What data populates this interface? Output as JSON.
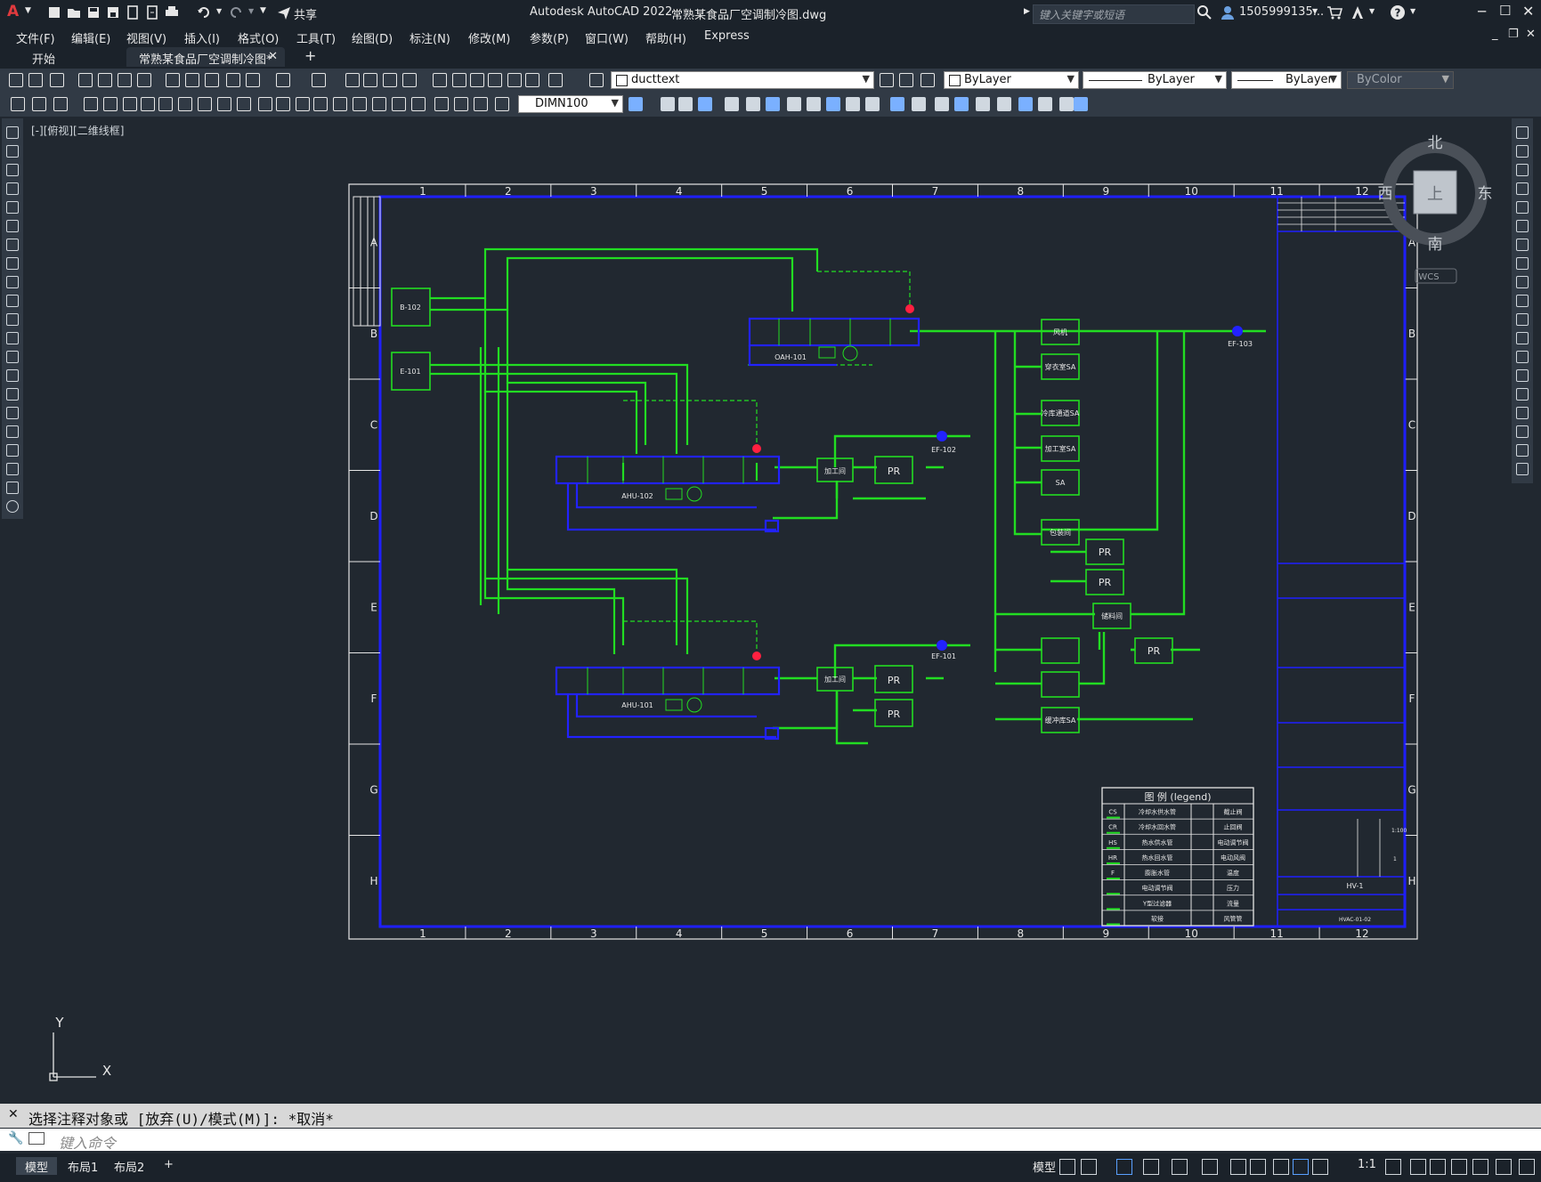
{
  "app": {
    "title": "Autodesk AutoCAD 2022",
    "file": "常熟某食品厂空调制冷图.dwg",
    "share": "共享",
    "search_placeholder": "键入关键字或短语",
    "user": "1505999135...",
    "logo": "A"
  },
  "menu": [
    "文件(F)",
    "编辑(E)",
    "视图(V)",
    "插入(I)",
    "格式(O)",
    "工具(T)",
    "绘图(D)",
    "标注(N)",
    "修改(M)",
    "参数(P)",
    "窗口(W)",
    "帮助(H)",
    "Express"
  ],
  "tabs": {
    "start": "开始",
    "doc": "常熟某食品厂空调制冷图*",
    "add": "+"
  },
  "toolbar": {
    "layer": "ducttext",
    "color": "ByLayer",
    "linetype": "ByLayer",
    "lineweight": "ByLayer",
    "plotstyle": "ByColor",
    "dimstyle": "DIMN100"
  },
  "viewport": {
    "label": "[-][俯视][二维线框]"
  },
  "viewcube": {
    "north": "北",
    "south": "南",
    "east": "东",
    "west": "西",
    "top": "上",
    "wcs": "WCS"
  },
  "ucs": {
    "x": "X",
    "y": "Y"
  },
  "drawing": {
    "col_labels": [
      "1",
      "2",
      "3",
      "4",
      "5",
      "6",
      "7",
      "8",
      "9",
      "10",
      "11",
      "12"
    ],
    "row_labels": [
      "A",
      "B",
      "C",
      "D",
      "E",
      "F",
      "G",
      "H"
    ],
    "units": {
      "b102": "B-102",
      "e101": "E-101",
      "oah": "OAH-101",
      "ahu102": "AHU-102",
      "ahu101": "AHU-101",
      "ef102": "EF-102",
      "ef101": "EF-101",
      "ef103": "EF-103",
      "pr": "PR",
      "jgj": "加工间",
      "jgj2": "加工间",
      "sa": "SA",
      "cwsa": "穿衣室SA",
      "jgsa": "加工室SA",
      "lsa": "冷库通道SA",
      "ghf": "包装间",
      "fx": "风机",
      "cl": "储料间",
      "kz": "缓冲库SA"
    },
    "legend_title": "图 例 (legend)",
    "legend_rows": [
      [
        "CS",
        "冷却水供水管",
        "",
        "截止阀"
      ],
      [
        "CR",
        "冷却水回水管",
        "",
        "止回阀"
      ],
      [
        "HS",
        "热水供水管",
        "",
        "电动调节阀"
      ],
      [
        "HR",
        "热水回水管",
        "",
        "电动风阀"
      ],
      [
        "F",
        "膨胀水管",
        "",
        "温度"
      ],
      [
        "",
        "电动调节阀",
        "",
        "压力"
      ],
      [
        "",
        "Y型过滤器",
        "",
        "流量"
      ],
      [
        "",
        "软接",
        "",
        "风管管"
      ]
    ],
    "title_block": {
      "scale": "1:100",
      "sheet": "1",
      "name": "HV-1",
      "drawing_no": "HVAC-01-02"
    }
  },
  "command": {
    "history": "选择注释对象或 [放弃(U)/模式(M)]: *取消*",
    "placeholder": "键入命令"
  },
  "status": {
    "tabs": [
      "模型",
      "布局1",
      "布局2"
    ],
    "add": "+",
    "model": "模型",
    "scale": "1:1"
  }
}
